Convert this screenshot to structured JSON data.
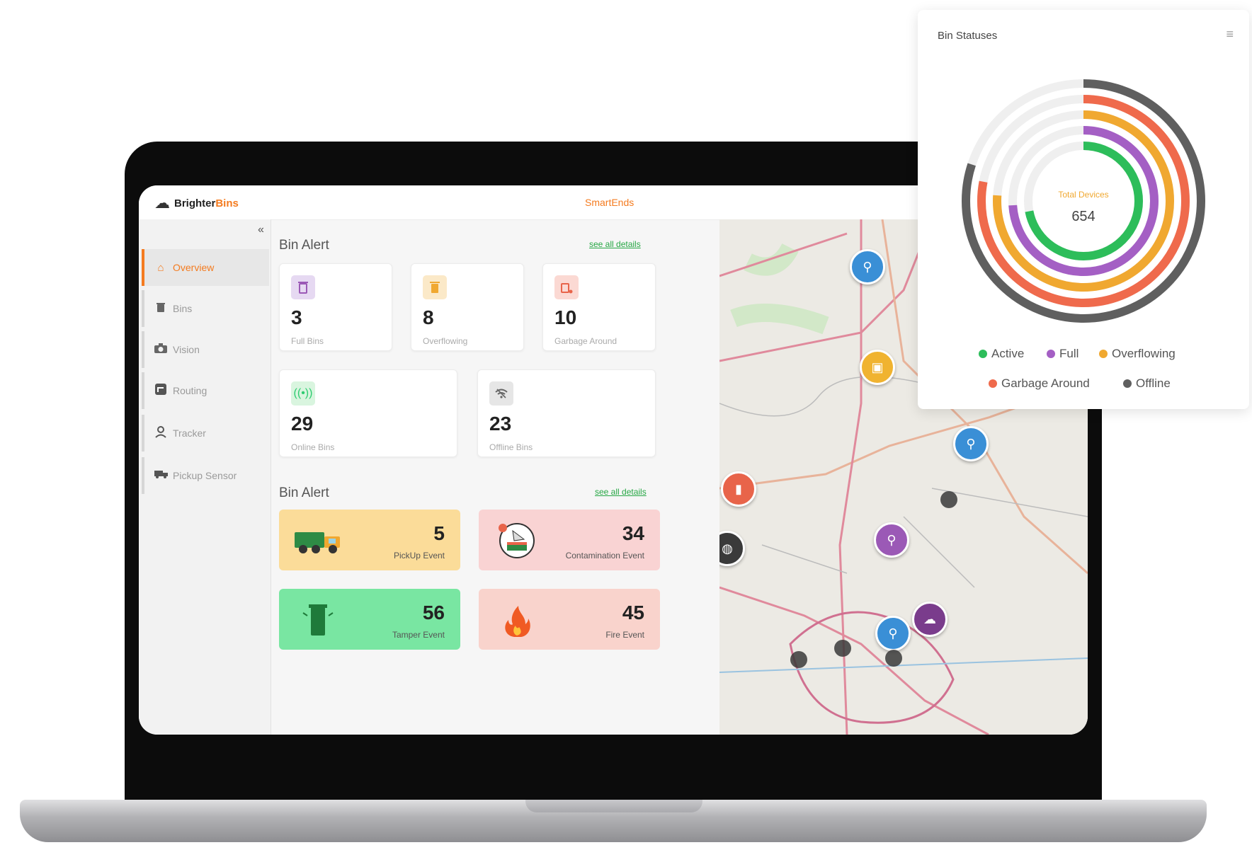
{
  "brand": {
    "name_part1": "Brighter",
    "name_part2": "Bins"
  },
  "app_title": "SmartEnds",
  "sidebar": {
    "collapse_glyph": "«",
    "items": [
      {
        "label": "Overview",
        "icon": "home-icon"
      },
      {
        "label": "Bins",
        "icon": "trash-icon"
      },
      {
        "label": "Vision",
        "icon": "camera-icon"
      },
      {
        "label": "Routing",
        "icon": "routing-icon"
      },
      {
        "label": "Tracker",
        "icon": "person-pin-icon"
      },
      {
        "label": "Pickup Sensor",
        "icon": "truck-icon"
      }
    ]
  },
  "bin_alert_1": {
    "title": "Bin Alert",
    "link": "see all details"
  },
  "bin_stats": [
    {
      "value": "3",
      "label": "Full Bins",
      "color": "#e6d9f2",
      "icon_color": "#9b59b6"
    },
    {
      "value": "8",
      "label": "Overflowing",
      "color": "#fbe9c8",
      "icon_color": "#f0a830"
    },
    {
      "value": "10",
      "label": "Garbage Around",
      "color": "#fbd9d3",
      "icon_color": "#e8644a"
    },
    {
      "value": "29",
      "label": "Online Bins",
      "color": "#d9f5df",
      "icon_color": "#2ecc71"
    },
    {
      "value": "23",
      "label": "Offline Bins",
      "color": "#e6e6e6",
      "icon_color": "#666666"
    }
  ],
  "bin_alert_2": {
    "title": "Bin Alert",
    "link": "see all details"
  },
  "events": [
    {
      "value": "5",
      "label": "PickUp Event",
      "bg": "#fbdc99",
      "icon": "garbage-truck-icon"
    },
    {
      "value": "34",
      "label": "Contamination Event",
      "bg": "#f9d3d3",
      "icon": "contamination-icon"
    },
    {
      "value": "56",
      "label": "Tamper Event",
      "bg": "#79e6a2",
      "icon": "green-bin-icon"
    },
    {
      "value": "45",
      "label": "Fire Event",
      "bg": "#f9d3cc",
      "icon": "fire-icon"
    }
  ],
  "status_card": {
    "title": "Bin Statuses",
    "center_label": "Total Devices",
    "center_value": "654",
    "legend": [
      {
        "label": "Active",
        "color": "#2dbd5a"
      },
      {
        "label": "Full",
        "color": "#a45fc4"
      },
      {
        "label": "Overflowing",
        "color": "#f0a830"
      },
      {
        "label": "Garbage Around",
        "color": "#ef6a4c"
      },
      {
        "label": "Offline",
        "color": "#5f5f5f"
      }
    ]
  },
  "chart_data": {
    "type": "radialBar",
    "title": "Bin Statuses",
    "series": [
      {
        "name": "Active",
        "value": 72
      },
      {
        "name": "Full",
        "value": 74
      },
      {
        "name": "Overflowing",
        "value": 76
      },
      {
        "name": "Garbage Around",
        "value": 78
      },
      {
        "name": "Offline",
        "value": 80
      }
    ],
    "unit": "percent"
  }
}
